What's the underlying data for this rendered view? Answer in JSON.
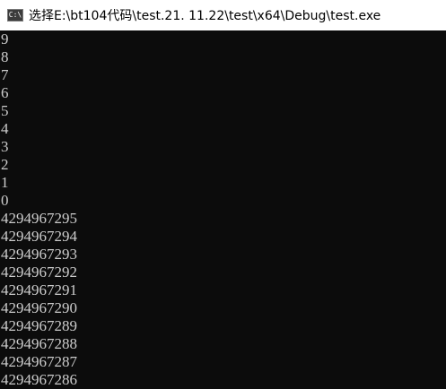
{
  "window": {
    "title": "选择E:\\bt104代码\\test.21. 11.22\\test\\x64\\Debug\\test.exe",
    "icon": "console-app-icon",
    "icon_glyph": "C:\\",
    "colors": {
      "titlebar_bg": "#ffffff",
      "console_bg": "#0c0c0c",
      "console_text": "#cccccc"
    }
  },
  "console": {
    "lines": [
      "9",
      "8",
      "7",
      "6",
      "5",
      "4",
      "3",
      "2",
      "1",
      "0",
      "4294967295",
      "4294967294",
      "4294967293",
      "4294967292",
      "4294967291",
      "4294967290",
      "4294967289",
      "4294967288",
      "4294967287",
      "4294967286"
    ]
  }
}
